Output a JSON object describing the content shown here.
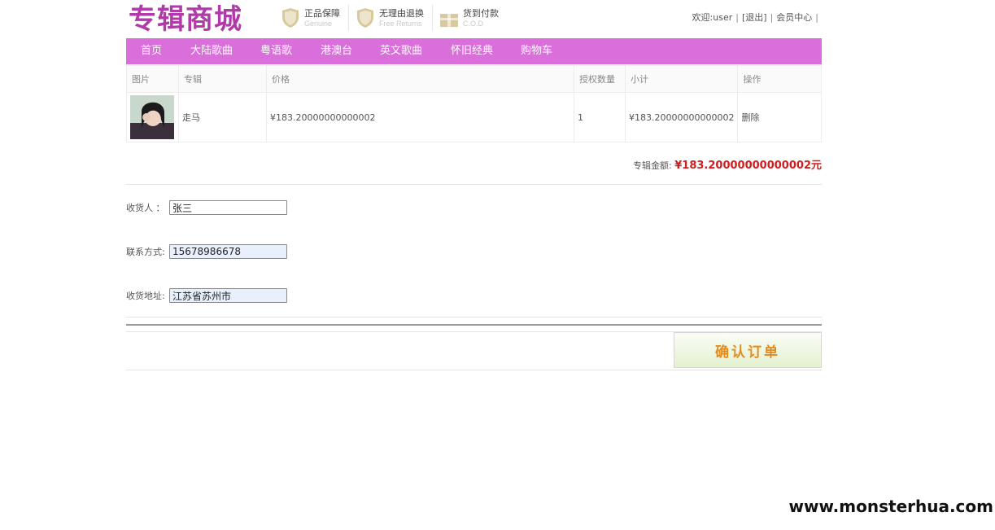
{
  "header": {
    "logo": "专辑商城",
    "badges": [
      {
        "icon": "shield-genuine-icon",
        "title": "正品保障",
        "subtitle": "Genuine"
      },
      {
        "icon": "shield-return-icon",
        "title": "无理由退换",
        "subtitle": "Free Returns"
      },
      {
        "icon": "gift-cod-icon",
        "title": "货到付款",
        "subtitle": "C.O.D"
      }
    ],
    "welcome": "欢迎:user",
    "logout": "[退出]",
    "member_center": "会员中心",
    "sep": "|"
  },
  "nav": [
    "首页",
    "大陆歌曲",
    "粤语歌",
    "港澳台",
    "英文歌曲",
    "怀旧经典",
    "购物车"
  ],
  "cart": {
    "columns": [
      "图片",
      "专辑",
      "价格",
      "授权数量",
      "小计",
      "操作"
    ],
    "rows": [
      {
        "image": "album-cover-image",
        "album": "走马",
        "price": "¥183.20000000000002",
        "qty": "1",
        "subtotal": "¥183.20000000000002",
        "action": "删除"
      }
    ]
  },
  "total": {
    "label": "专辑金额:",
    "value": "¥183.20000000000002元"
  },
  "form": {
    "receiver_label": "收货人 ：",
    "receiver_value": "张三",
    "phone_label": "联系方式:",
    "phone_value": "15678986678",
    "address_label": "收货地址:",
    "address_value": "江苏省苏州市"
  },
  "confirm_label": "确认订单",
  "watermark": "www.monsterhua.com",
  "colors": {
    "nav_bg": "#da6edb",
    "logo": "#b03aa8",
    "total": "#d21d1d",
    "confirm_text": "#e58a1b"
  }
}
